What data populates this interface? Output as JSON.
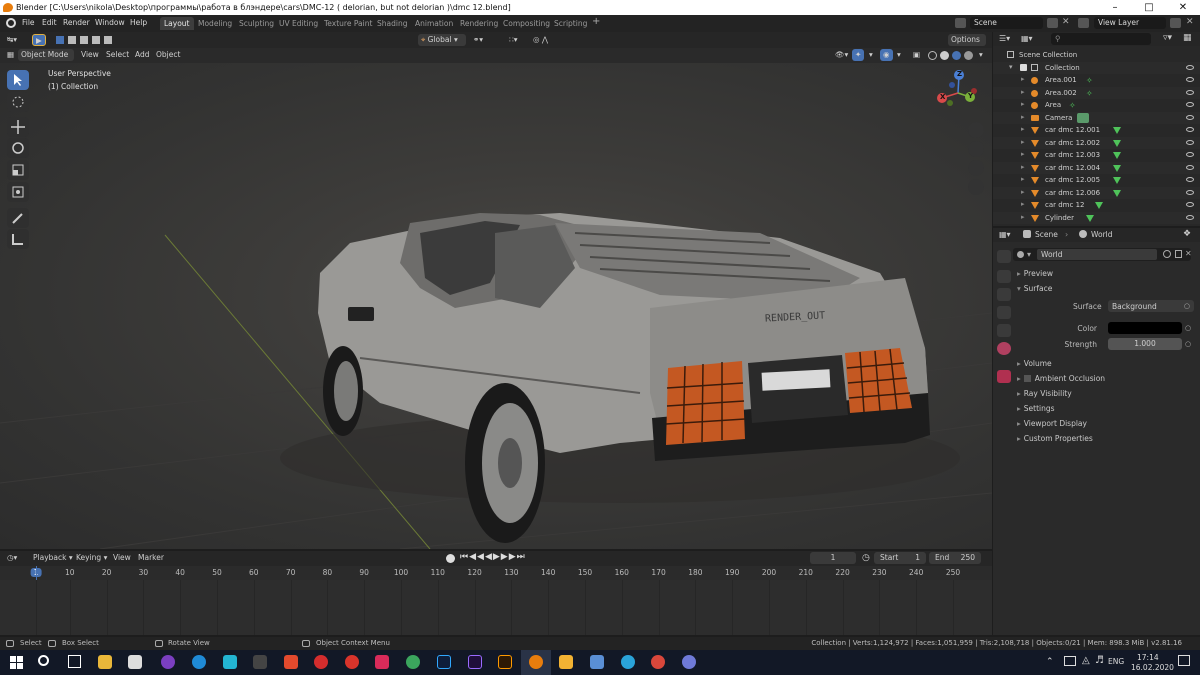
{
  "window": {
    "title": "Blender [C:\\Users\\nikola\\Desktop\\программы\\работа в блэндере\\cars\\DMC-12 ( delorian, but not delorian )\\dmc 12.blend]"
  },
  "menu": [
    "File",
    "Edit",
    "Render",
    "Window",
    "Help"
  ],
  "workspaces": [
    "Layout",
    "Modeling",
    "Sculpting",
    "UV Editing",
    "Texture Paint",
    "Shading",
    "Animation",
    "Rendering",
    "Compositing",
    "Scripting"
  ],
  "active_workspace": "Layout",
  "scene_field": "Scene",
  "view_layer_field": "View Layer",
  "viewport": {
    "orientation": "Global",
    "options_label": "Options",
    "mode": "Object Mode",
    "menus": [
      "View",
      "Select",
      "Add",
      "Object"
    ],
    "overlay_title": "User Perspective",
    "overlay_subtitle": "(1) Collection",
    "license_plate": "RENDER_OUT",
    "gizmo": {
      "z": "Z",
      "x": "X",
      "y": "Y"
    }
  },
  "outliner": {
    "root": "Scene Collection",
    "collection": "Collection",
    "items": [
      {
        "name": "Area.001",
        "kind": "light"
      },
      {
        "name": "Area.002",
        "kind": "light"
      },
      {
        "name": "Area",
        "kind": "light"
      },
      {
        "name": "Camera",
        "kind": "camera"
      },
      {
        "name": "car dmc 12.001",
        "kind": "mesh"
      },
      {
        "name": "car dmc 12.002",
        "kind": "mesh"
      },
      {
        "name": "car dmc 12.003",
        "kind": "mesh"
      },
      {
        "name": "car dmc 12.004",
        "kind": "mesh"
      },
      {
        "name": "car dmc 12.005",
        "kind": "mesh"
      },
      {
        "name": "car dmc 12.006",
        "kind": "mesh"
      },
      {
        "name": "car dmc 12",
        "kind": "mesh"
      },
      {
        "name": "Cylinder",
        "kind": "mesh"
      }
    ]
  },
  "properties": {
    "breadcrumb_scene": "Scene",
    "breadcrumb_world": "World",
    "world_name": "World",
    "sections_top": [
      "Preview",
      "Surface"
    ],
    "surface_label": "Surface",
    "surface_value": "Background",
    "color_label": "Color",
    "color_value": "#000000",
    "strength_label": "Strength",
    "strength_value": "1.000",
    "sections_bottom": [
      "Volume",
      "Ambient Occlusion",
      "Ray Visibility",
      "Settings",
      "Viewport Display",
      "Custom Properties"
    ]
  },
  "timeline": {
    "menus": [
      "Playback",
      "Keying",
      "View",
      "Marker"
    ],
    "current_frame": "1",
    "start_label": "Start",
    "start_value": "1",
    "end_label": "End",
    "end_value": "250",
    "ruler": [
      "1",
      "10",
      "20",
      "30",
      "40",
      "50",
      "60",
      "70",
      "80",
      "90",
      "100",
      "110",
      "120",
      "130",
      "140",
      "150",
      "160",
      "170",
      "180",
      "190",
      "200",
      "210",
      "220",
      "230",
      "240",
      "250"
    ]
  },
  "statusbar": {
    "select": "Select",
    "box_select": "Box Select",
    "rotate_view": "Rotate View",
    "context_menu": "Object Context Menu",
    "stats": "Collection | Verts:1,124,972 | Faces:1,051,959 | Tris:2,108,718 | Objects:0/21 | Mem: 898.3 MiB | v2.81.16"
  },
  "taskbar": {
    "lang": "ENG",
    "time": "17:14",
    "date": "16.02.2020"
  },
  "colors": {
    "accent": "#4772b3",
    "blender_orange": "#e87d0d",
    "ruler_marker": "#4772b3"
  }
}
